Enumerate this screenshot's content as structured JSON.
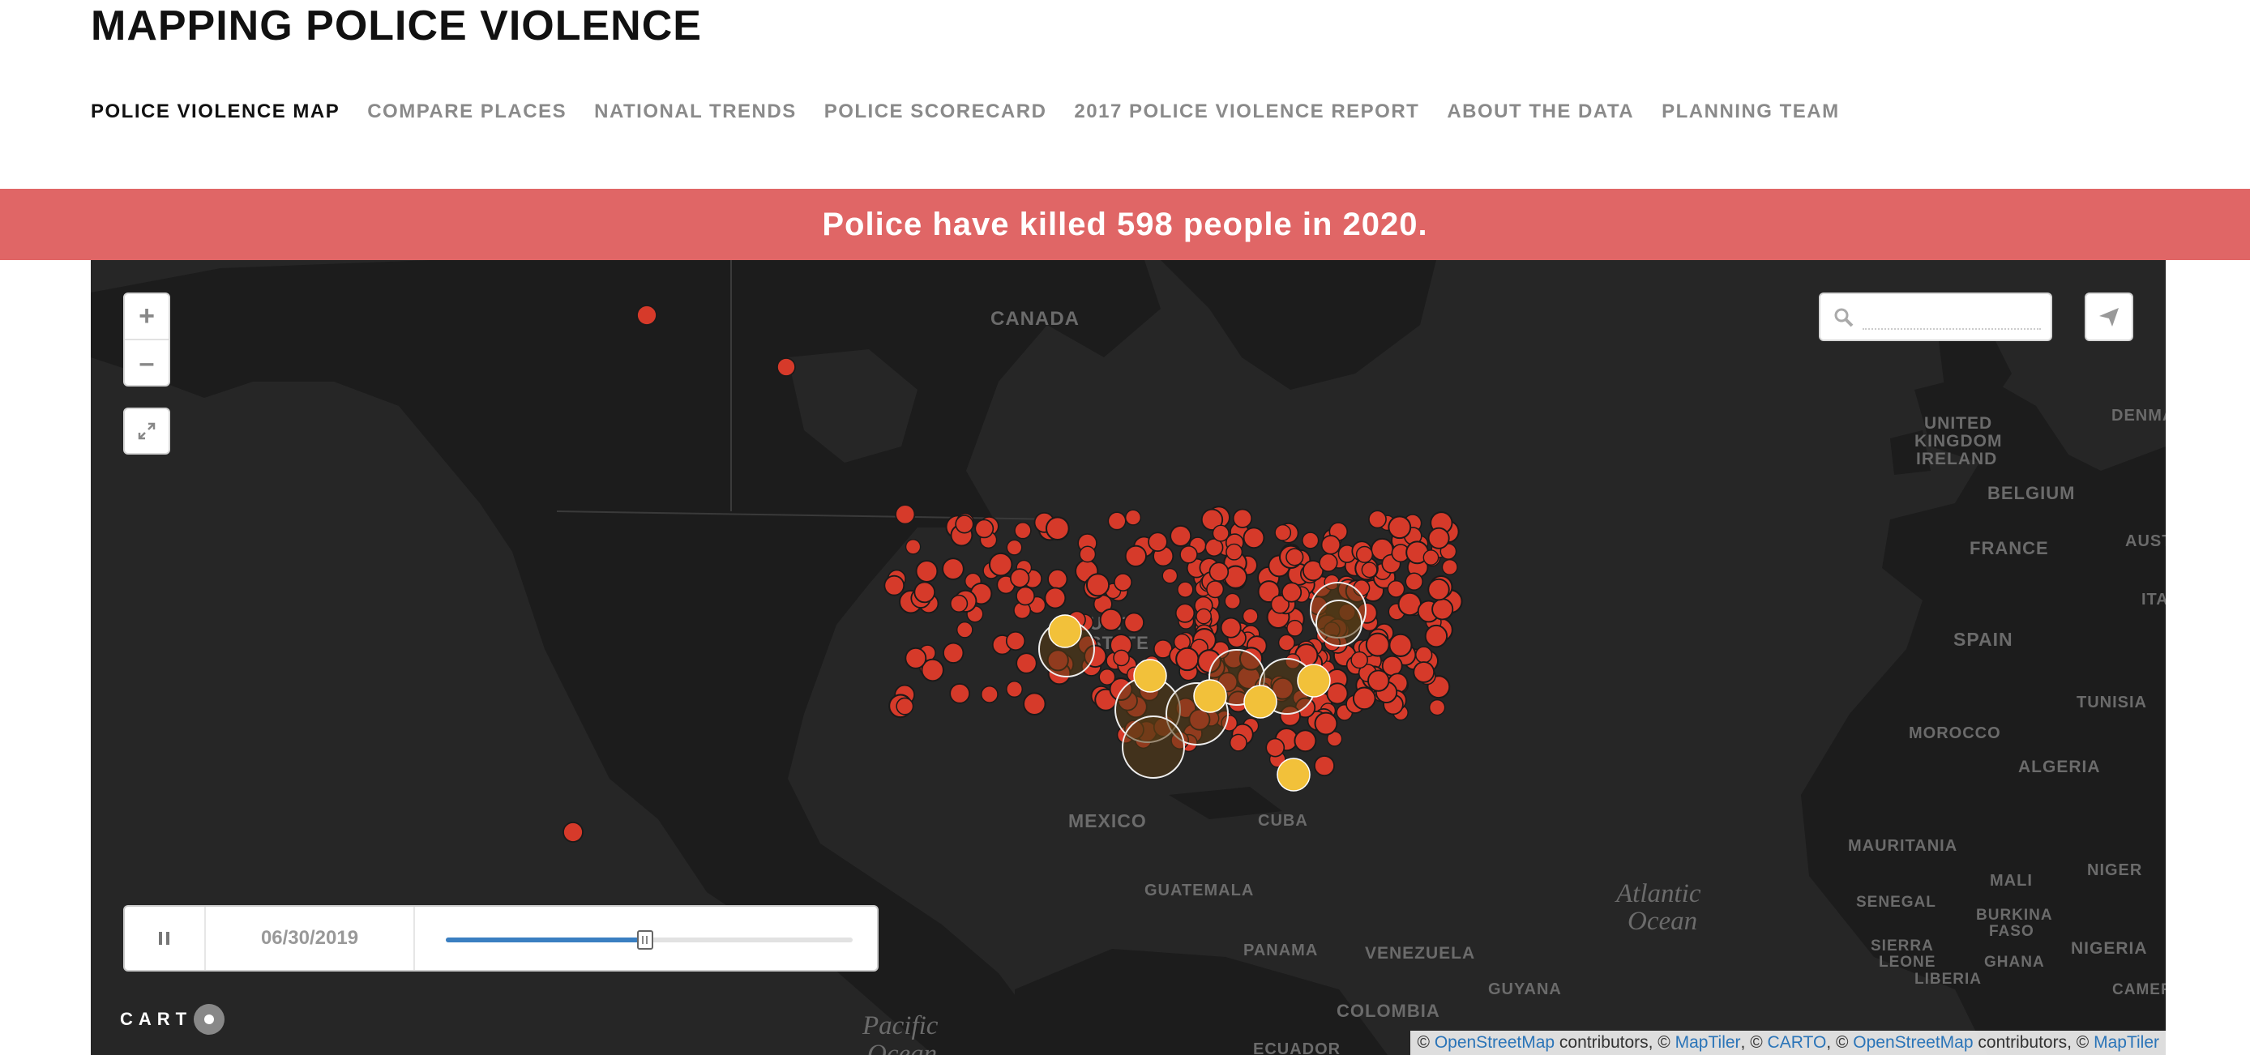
{
  "site": {
    "title": "MAPPING POLICE VIOLENCE"
  },
  "nav": {
    "items": [
      {
        "label": "POLICE VIOLENCE MAP",
        "active": true
      },
      {
        "label": "COMPARE PLACES"
      },
      {
        "label": "NATIONAL TRENDS"
      },
      {
        "label": "POLICE SCORECARD"
      },
      {
        "label": "2017 POLICE VIOLENCE REPORT"
      },
      {
        "label": "ABOUT THE DATA"
      },
      {
        "label": "PLANNING TEAM"
      }
    ]
  },
  "banner": {
    "text": "Police have killed 598 people in 2020."
  },
  "map": {
    "zoom_in": "+",
    "zoom_out": "–",
    "search_placeholder": "",
    "labels": {
      "canada": "CANADA",
      "united_kingdom_1": "UNITED",
      "united_kingdom_2": "KINGDOM",
      "ireland": "IRELAND",
      "denmark": "DENMARK",
      "belgium": "BELGIUM",
      "france": "FRANCE",
      "austria": "AUSTR",
      "italy": "ITAL",
      "spain": "SPAIN",
      "tunisia": "TUNISIA",
      "morocco": "MOROCCO",
      "algeria": "ALGERIA",
      "mauritania": "MAURITANIA",
      "mali": "MALI",
      "niger": "NIGER",
      "senegal": "SENEGAL",
      "burkina_1": "BURKINA",
      "burkina_2": "FASO",
      "nigeria": "NIGERIA",
      "sierra_1": "SIERRA",
      "sierra_2": "LEONE",
      "ghana": "GHANA",
      "liberia": "LIBERIA",
      "cameroon": "CAMER",
      "mexico": "MEXICO",
      "cuba": "CUBA",
      "guatemala": "GUATEMALA",
      "panama": "PANAMA",
      "venezuela": "VENEZUELA",
      "guyana": "GUYANA",
      "colombia": "COLOMBIA",
      "ecuador": "ECUADOR",
      "atlantic_1": "Atlantic",
      "atlantic_2": "Ocean",
      "pacific_1": "Pacific",
      "pacific_2": "Ocean",
      "us_partial_1": "UNIT",
      "us_partial_2": "STATE"
    },
    "colors": {
      "marker": "#d63a2a",
      "cluster": "#f2c13a",
      "land": "#1f1f1f",
      "water": "#262626"
    }
  },
  "timeline": {
    "date": "06/30/2019",
    "progress": 0.49
  },
  "carto": {
    "label": "CART"
  },
  "attribution": {
    "c1": "©",
    "osm1": "OpenStreetMap",
    "t1": "contributors, ©",
    "maptiler1": "MapTiler",
    "t2": ", ©",
    "carto": "CARTO",
    "t3": ", ©",
    "osm2": "OpenStreetMap",
    "t4": "contributors, ©",
    "maptiler2": "MapTiler"
  }
}
